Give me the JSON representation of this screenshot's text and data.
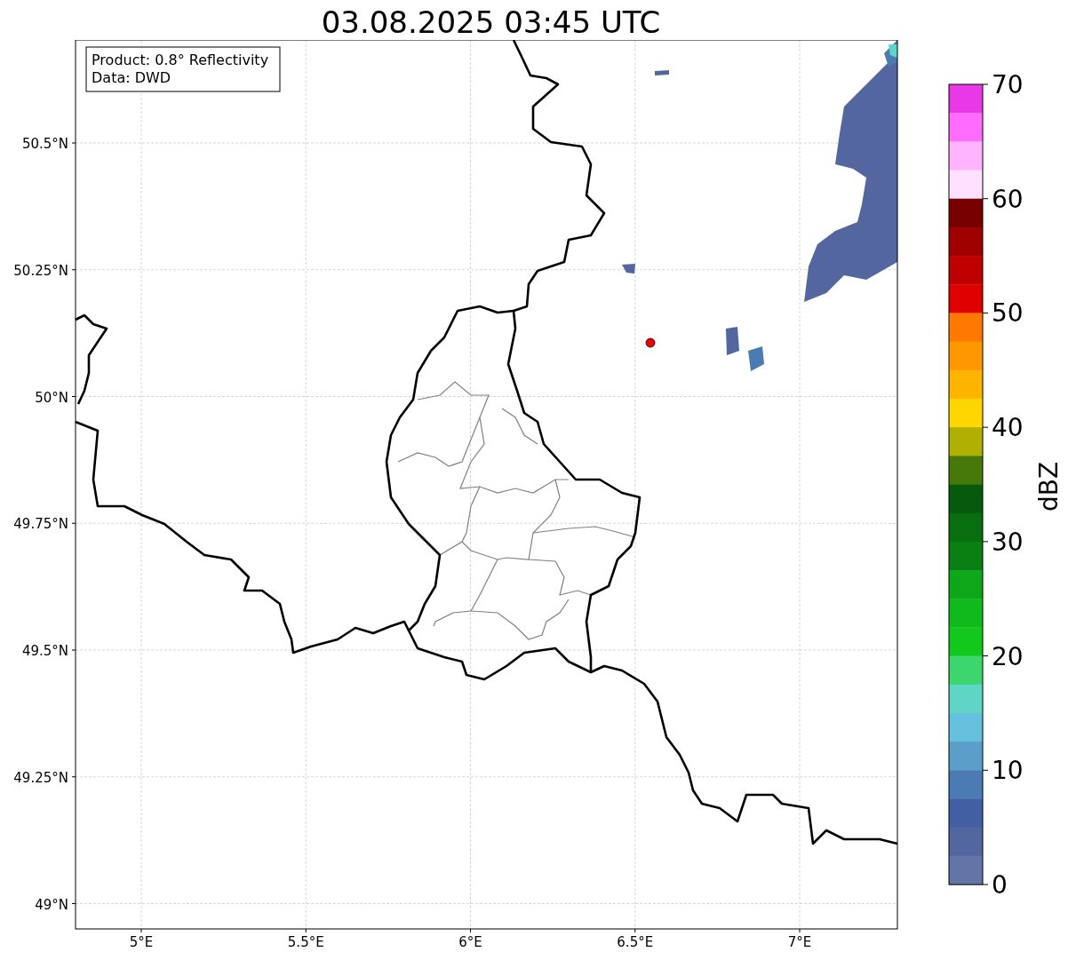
{
  "title": "03.08.2025 03:45 UTC",
  "map": {
    "info_box": [
      "Product: 0.8° Reflectivity",
      "Data: DWD"
    ],
    "lon_ticks": [
      "5°E",
      "5.5°E",
      "6°E",
      "6.5°E",
      "7°E"
    ],
    "lat_ticks": [
      "50.5°N",
      "50.25°N",
      "50°N",
      "49.75°N",
      "49.5°N",
      "49.25°N",
      "49°N"
    ]
  },
  "colorbar": {
    "label": "dBZ",
    "ticks": [
      "70",
      "60",
      "50",
      "40",
      "30",
      "20",
      "10",
      "0"
    ],
    "levels": [
      {
        "color": "#e838e8"
      },
      {
        "color": "#ff6cff"
      },
      {
        "color": "#ffb4ff"
      },
      {
        "color": "#ffe0ff"
      },
      {
        "color": "#780000"
      },
      {
        "color": "#a00000"
      },
      {
        "color": "#c00000"
      },
      {
        "color": "#e00000"
      },
      {
        "color": "#ff7800"
      },
      {
        "color": "#ff9800"
      },
      {
        "color": "#ffb400"
      },
      {
        "color": "#ffd700"
      },
      {
        "color": "#b0b000"
      },
      {
        "color": "#47780a"
      },
      {
        "color": "#075a0d"
      },
      {
        "color": "#086e10"
      },
      {
        "color": "#0a8014"
      },
      {
        "color": "#0ea71a"
      },
      {
        "color": "#10b91c"
      },
      {
        "color": "#12c81d"
      },
      {
        "color": "#3dd66e"
      },
      {
        "color": "#5fd6c5"
      },
      {
        "color": "#64c0dc"
      },
      {
        "color": "#5a9ec9"
      },
      {
        "color": "#4b7bb3"
      },
      {
        "color": "#435fa3"
      },
      {
        "color": "#5366a0"
      },
      {
        "color": "#6374a6"
      }
    ]
  }
}
